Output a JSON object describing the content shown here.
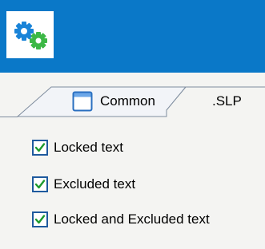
{
  "header": {
    "icon": "gears-icon",
    "colors": {
      "background": "#0a78c8",
      "gear_blue": "#1a84d8",
      "gear_green": "#3cb846"
    }
  },
  "tabs": [
    {
      "label": "Common",
      "icon": "window-icon",
      "selected": false
    },
    {
      "label": ".SLP",
      "selected": true
    }
  ],
  "options": [
    {
      "label": "Locked text",
      "checked": true
    },
    {
      "label": "Excluded text",
      "checked": true
    },
    {
      "label": "Locked and Excluded text",
      "checked": true
    }
  ]
}
